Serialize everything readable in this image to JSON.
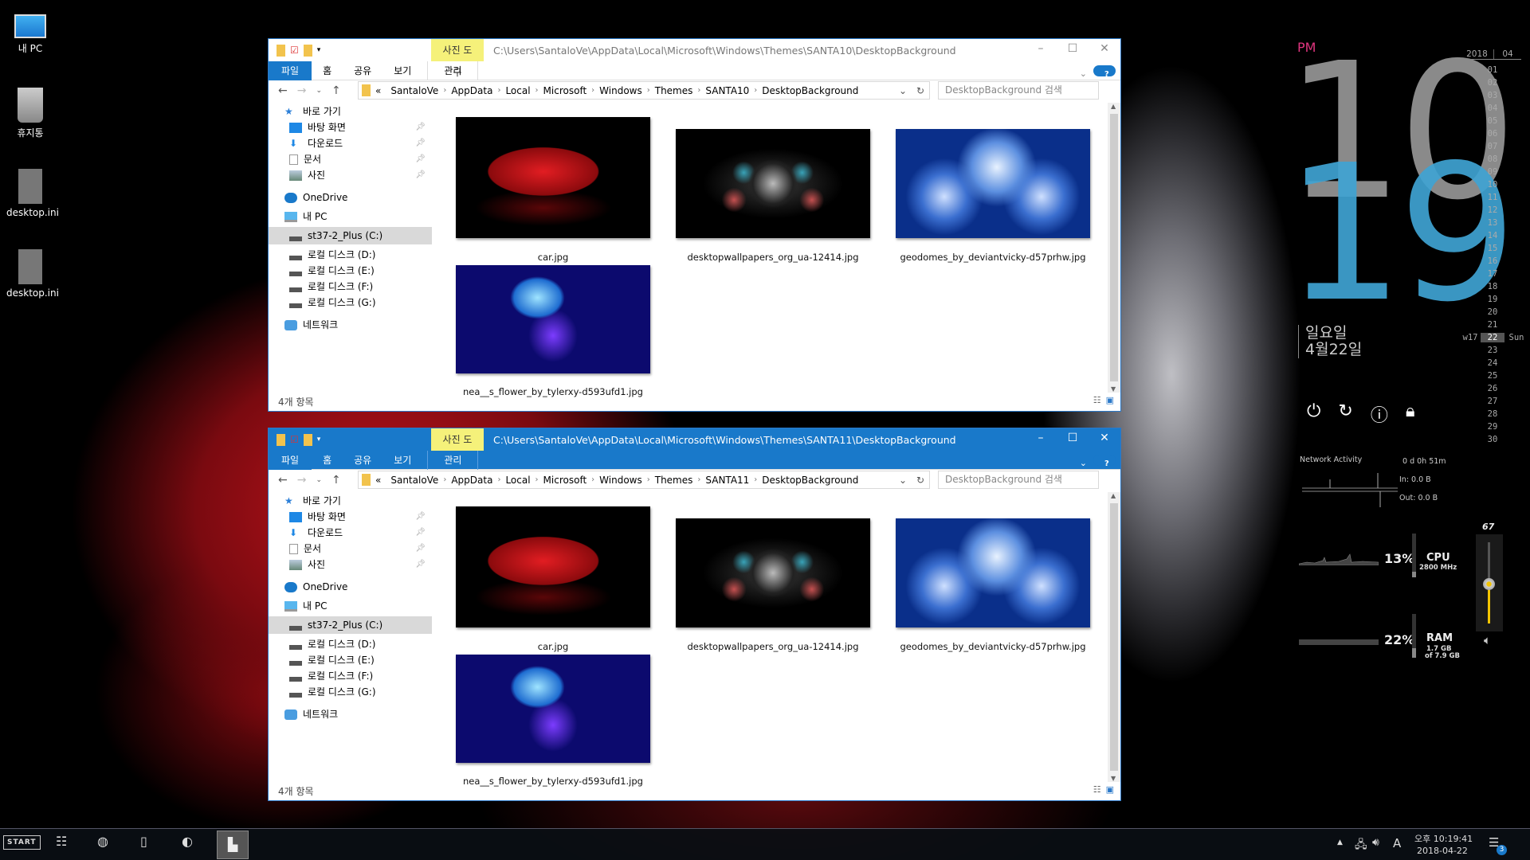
{
  "desktop_icons": [
    {
      "label": "내 PC",
      "icon": "pc-icon"
    },
    {
      "label": "휴지통",
      "icon": "recycle-bin-icon"
    },
    {
      "label": "desktop.ini",
      "icon": "settings-file-icon"
    },
    {
      "label": "desktop.ini",
      "icon": "settings-file-icon"
    }
  ],
  "windows": [
    {
      "active": false,
      "tool_tab": "사진 도구",
      "title_path": "C:\\Users\\SantaloVe\\AppData\\Local\\Microsoft\\Windows\\Themes\\SANTA10\\DesktopBackground",
      "breadcrumb": [
        "SantaloVe",
        "AppData",
        "Local",
        "Microsoft",
        "Windows",
        "Themes",
        "SANTA10",
        "DesktopBackground"
      ]
    },
    {
      "active": true,
      "tool_tab": "사진 도구",
      "title_path": "C:\\Users\\SantaloVe\\AppData\\Local\\Microsoft\\Windows\\Themes\\SANTA11\\DesktopBackground",
      "breadcrumb": [
        "SantaloVe",
        "AppData",
        "Local",
        "Microsoft",
        "Windows",
        "Themes",
        "SANTA11",
        "DesktopBackground"
      ]
    }
  ],
  "explorer": {
    "ribbon_tabs": [
      "파일",
      "홈",
      "공유",
      "보기",
      "관리"
    ],
    "search_placeholder": "DesktopBackground 검색",
    "breadcrumb_prefix": "«",
    "sidebar": [
      {
        "label": "바로 가기",
        "icon": "star-icon",
        "level": 0
      },
      {
        "label": "바탕 화면",
        "icon": "desktop-icon",
        "level": 1,
        "pinned": true
      },
      {
        "label": "다운로드",
        "icon": "download-icon",
        "level": 1,
        "pinned": true
      },
      {
        "label": "문서",
        "icon": "document-icon",
        "level": 1,
        "pinned": true
      },
      {
        "label": "사진",
        "icon": "pictures-icon",
        "level": 1,
        "pinned": true
      },
      {
        "label": "OneDrive",
        "icon": "cloud-icon",
        "level": 0
      },
      {
        "label": "내 PC",
        "icon": "pc-icon",
        "level": 0
      },
      {
        "label": "st37-2_Plus (C:)",
        "icon": "drive-icon",
        "level": 1,
        "selected": true
      },
      {
        "label": "로컬 디스크 (D:)",
        "icon": "drive-icon",
        "level": 1
      },
      {
        "label": "로컬 디스크 (E:)",
        "icon": "drive-icon",
        "level": 1
      },
      {
        "label": "로컬 디스크 (F:)",
        "icon": "drive-icon",
        "level": 1
      },
      {
        "label": "로컬 디스크 (G:)",
        "icon": "drive-icon",
        "level": 1
      },
      {
        "label": "네트워크",
        "icon": "network-icon",
        "level": 0
      }
    ],
    "files": [
      {
        "name": "car.jpg",
        "thumb": "car"
      },
      {
        "name": "desktopwallpapers_org_ua-12414.jpg",
        "thumb": "fract"
      },
      {
        "name": "geodomes_by_deviantvicky-d57prhw.jpg",
        "thumb": "geo"
      },
      {
        "name": "nea__s_flower_by_tylerxy-d593ufd1.jpg",
        "thumb": "flower"
      }
    ],
    "status": "4개 항목"
  },
  "clock": {
    "ampm": "PM",
    "hour": "10",
    "minute": "19",
    "weekday": "일요일",
    "date": "4월22일"
  },
  "calendar": {
    "year": "2018",
    "month": "04",
    "week": "w17",
    "today": "22",
    "today_dow": "Sun",
    "days": [
      "01",
      "02",
      "03",
      "04",
      "05",
      "06",
      "07",
      "08",
      "09",
      "10",
      "11",
      "12",
      "13",
      "14",
      "15",
      "16",
      "17",
      "18",
      "19",
      "20",
      "21",
      "22",
      "23",
      "24",
      "25",
      "26",
      "27",
      "28",
      "29",
      "30"
    ]
  },
  "system": {
    "network_title": "Network Activity",
    "uptime": "0 d 0h 51m",
    "net_in": "In: 0.0 B",
    "net_out": "Out: 0.0 B",
    "cpu_pct": "13%",
    "cpu_label": "CPU",
    "cpu_freq": "2800 MHz",
    "ram_pct": "22%",
    "ram_label": "RAM",
    "ram_used": "1.7 GB",
    "ram_total": "of 7.9 GB",
    "volume": "67"
  },
  "taskbar": {
    "start": "START",
    "time": "오후 10:19:41",
    "date": "2018-04-22",
    "notifications": "3",
    "ime": "A"
  },
  "colors": {
    "accent": "#1979ca",
    "clock_hour": "#8a8a8a",
    "clock_minute": "#3fa3d2",
    "ampm": "#e0357f",
    "tool_tab": "#f5f17a",
    "volume": "#f3c400"
  }
}
